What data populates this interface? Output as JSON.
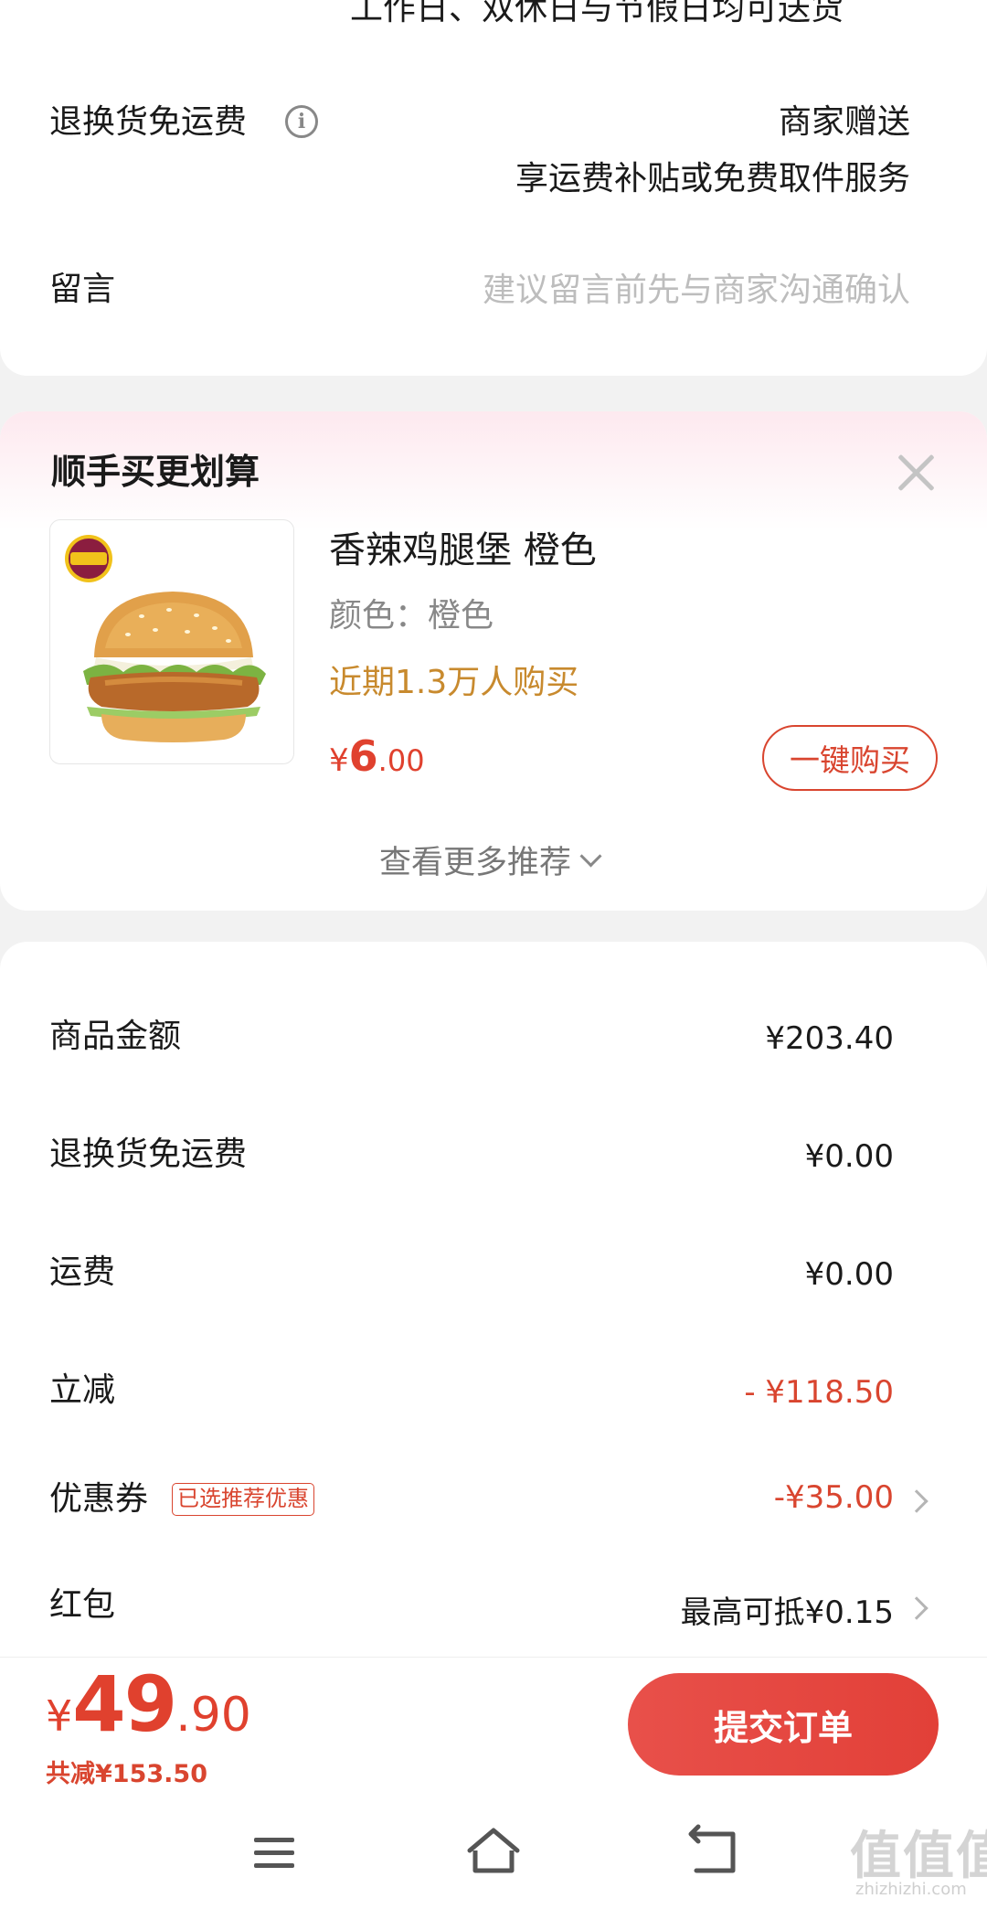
{
  "delivery": {
    "note": "工作日、双休日与节假日均可送货"
  },
  "return_shipping": {
    "label": "退换货免运费",
    "value_line1": "商家赠送",
    "value_line2": "享运费补贴或免费取件服务"
  },
  "message": {
    "label": "留言",
    "placeholder": "建议留言前先与商家沟通确认"
  },
  "recommend": {
    "title": "顺手买更划算",
    "product": {
      "name": "香辣鸡腿堡 橙色",
      "spec": "颜色：橙色",
      "sales": "近期1.3万人购买",
      "price_currency": "¥",
      "price_int": "6",
      "price_dec": ".00",
      "buy_label": "一键购买"
    },
    "more_label": "查看更多推荐"
  },
  "summary": {
    "rows": [
      {
        "label": "商品金额",
        "value": "¥203.40"
      },
      {
        "label": "退换货免运费",
        "value": "¥0.00"
      },
      {
        "label": "运费",
        "value": "¥0.00"
      },
      {
        "label": "立减",
        "value": "- ¥118.50"
      },
      {
        "label": "优惠券",
        "badge": "已选推荐优惠",
        "value": "-¥35.00"
      },
      {
        "label": "红包",
        "value": "最高可抵¥0.15"
      }
    ]
  },
  "footer": {
    "total_currency": "¥",
    "total_int": "49",
    "total_dec": ".90",
    "discount": "共减¥153.50",
    "submit_label": "提交订单"
  },
  "watermark": {
    "text": "值值值",
    "url": "zhizhizhi.com"
  },
  "colors": {
    "accent": "#e0412e",
    "sales": "#c88a2e",
    "background": "#f2f2f2"
  }
}
